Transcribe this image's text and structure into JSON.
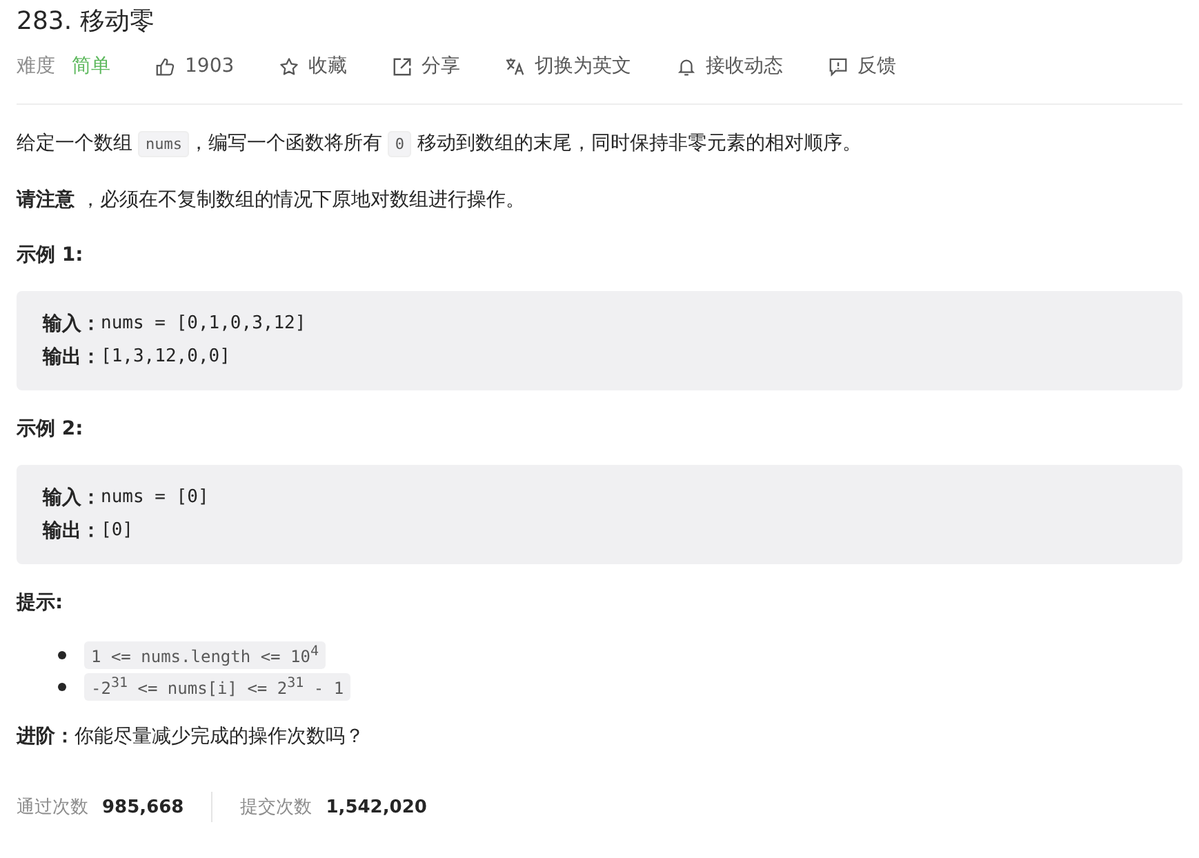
{
  "title": "283. 移动零",
  "difficulty": {
    "label": "难度",
    "value": "简单",
    "color": "#5cb85c"
  },
  "actions": [
    {
      "kind": "like",
      "label": "1903"
    },
    {
      "kind": "favorite",
      "label": "收藏"
    },
    {
      "kind": "share",
      "label": "分享"
    },
    {
      "kind": "translate",
      "label": "切换为英文"
    },
    {
      "kind": "subscribe",
      "label": "接收动态"
    },
    {
      "kind": "feedback",
      "label": "反馈"
    }
  ],
  "description": [
    {
      "kind": "text",
      "text": "给定一个数组 "
    },
    {
      "kind": "code",
      "text": "nums"
    },
    {
      "kind": "text",
      "text": "，编写一个函数将所有 "
    },
    {
      "kind": "code",
      "text": "0"
    },
    {
      "kind": "text",
      "text": " 移动到数组的末尾，同时保持非零元素的相对顺序。"
    }
  ],
  "note": "**请注意** ，必须在不复制数组的情况下原地对数组进行操作。",
  "examples": [
    {
      "title": "示例 1:",
      "lines": [
        {
          "label": "输入：",
          "value": "nums = [0,1,0,3,12]"
        },
        {
          "label": "输出：",
          "value": "[1,3,12,0,0]"
        }
      ]
    },
    {
      "title": "示例 2:",
      "lines": [
        {
          "label": "输入：",
          "value": "nums = [0]"
        },
        {
          "label": "输出：",
          "value": "[0]"
        }
      ]
    }
  ],
  "hints_title": "提示:",
  "hints": [
    "1 <= nums.length <= 10$^{4}$",
    "-2$^{31}$  <= nums[i] <= 2$^{31}$  - 1"
  ],
  "advanced": "**进阶：**你能尽量减少完成的操作次数吗？",
  "stats": [
    {
      "label": "通过次数",
      "value": "985,668"
    },
    {
      "label": "提交次数",
      "value": "1,542,020"
    }
  ]
}
